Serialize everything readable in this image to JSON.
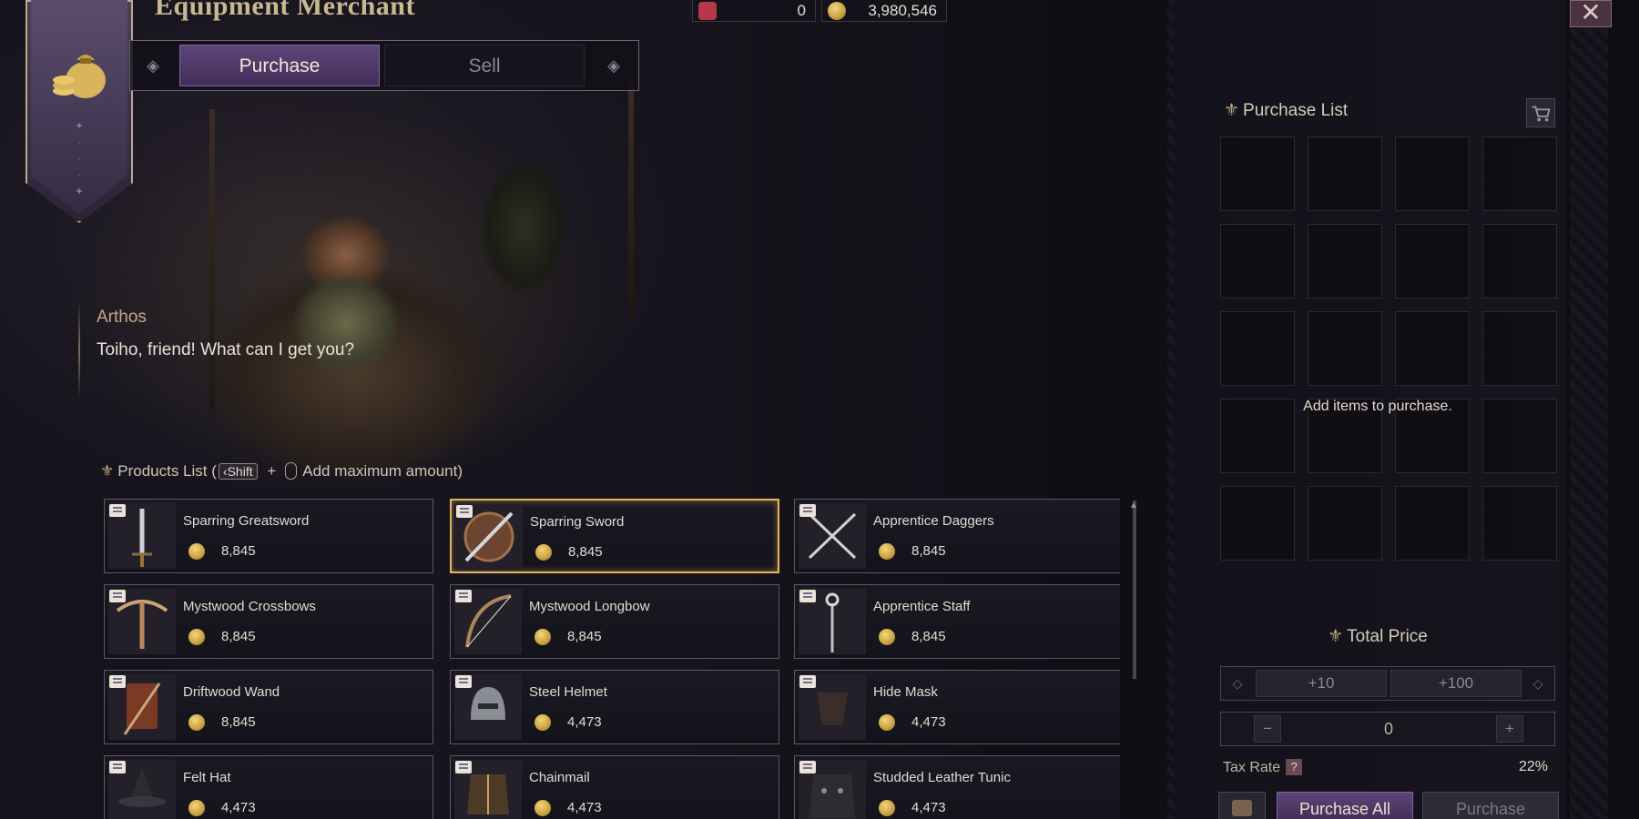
{
  "header": {
    "title": "Equipment Merchant",
    "tabs": [
      {
        "label": "Purchase",
        "active": true
      },
      {
        "label": "Sell",
        "active": false
      }
    ]
  },
  "currency": {
    "red_tokens": "0",
    "gold": "3,980,546"
  },
  "dialog": {
    "npc_name": "Arthos",
    "text": "Toiho, friend! What can I get you?"
  },
  "products_header": {
    "label": "Products List (",
    "key": "Shift",
    "plus": "+",
    "action": "Add maximum amount)"
  },
  "products": [
    {
      "name": "Sparring Greatsword",
      "price": "8,845",
      "icon": "greatsword-icon",
      "selected": false
    },
    {
      "name": "Sparring Sword",
      "price": "8,845",
      "icon": "sword-shield-icon",
      "selected": true
    },
    {
      "name": "Apprentice Daggers",
      "price": "8,845",
      "icon": "daggers-icon",
      "selected": false
    },
    {
      "name": "Mystwood Crossbows",
      "price": "8,845",
      "icon": "crossbow-icon",
      "selected": false
    },
    {
      "name": "Mystwood Longbow",
      "price": "8,845",
      "icon": "longbow-icon",
      "selected": false
    },
    {
      "name": "Apprentice Staff",
      "price": "8,845",
      "icon": "staff-icon",
      "selected": false
    },
    {
      "name": "Driftwood Wand",
      "price": "8,845",
      "icon": "wand-icon",
      "selected": false
    },
    {
      "name": "Steel Helmet",
      "price": "4,473",
      "icon": "helmet-icon",
      "selected": false
    },
    {
      "name": "Hide Mask",
      "price": "4,473",
      "icon": "mask-icon",
      "selected": false
    },
    {
      "name": "Felt Hat",
      "price": "4,473",
      "icon": "hat-icon",
      "selected": false
    },
    {
      "name": "Chainmail",
      "price": "4,473",
      "icon": "chainmail-icon",
      "selected": false
    },
    {
      "name": "Studded Leather Tunic",
      "price": "4,473",
      "icon": "tunic-icon",
      "selected": false
    }
  ],
  "purchase_list": {
    "title": "Purchase List",
    "empty_message": "Add items to purchase.",
    "slot_count": 20
  },
  "total": {
    "title": "Total Price",
    "plus10": "+10",
    "plus100": "+100",
    "minus": "−",
    "plus": "+",
    "quantity": "0",
    "tax_label": "Tax Rate",
    "tax_help": "?",
    "tax_value": "22%"
  },
  "buttons": {
    "purchase_all": "Purchase All",
    "purchase": "Purchase"
  },
  "colors": {
    "accent_purple": "#5e4478",
    "highlight_gold": "#e3b65c",
    "coin": "#c9a040"
  }
}
